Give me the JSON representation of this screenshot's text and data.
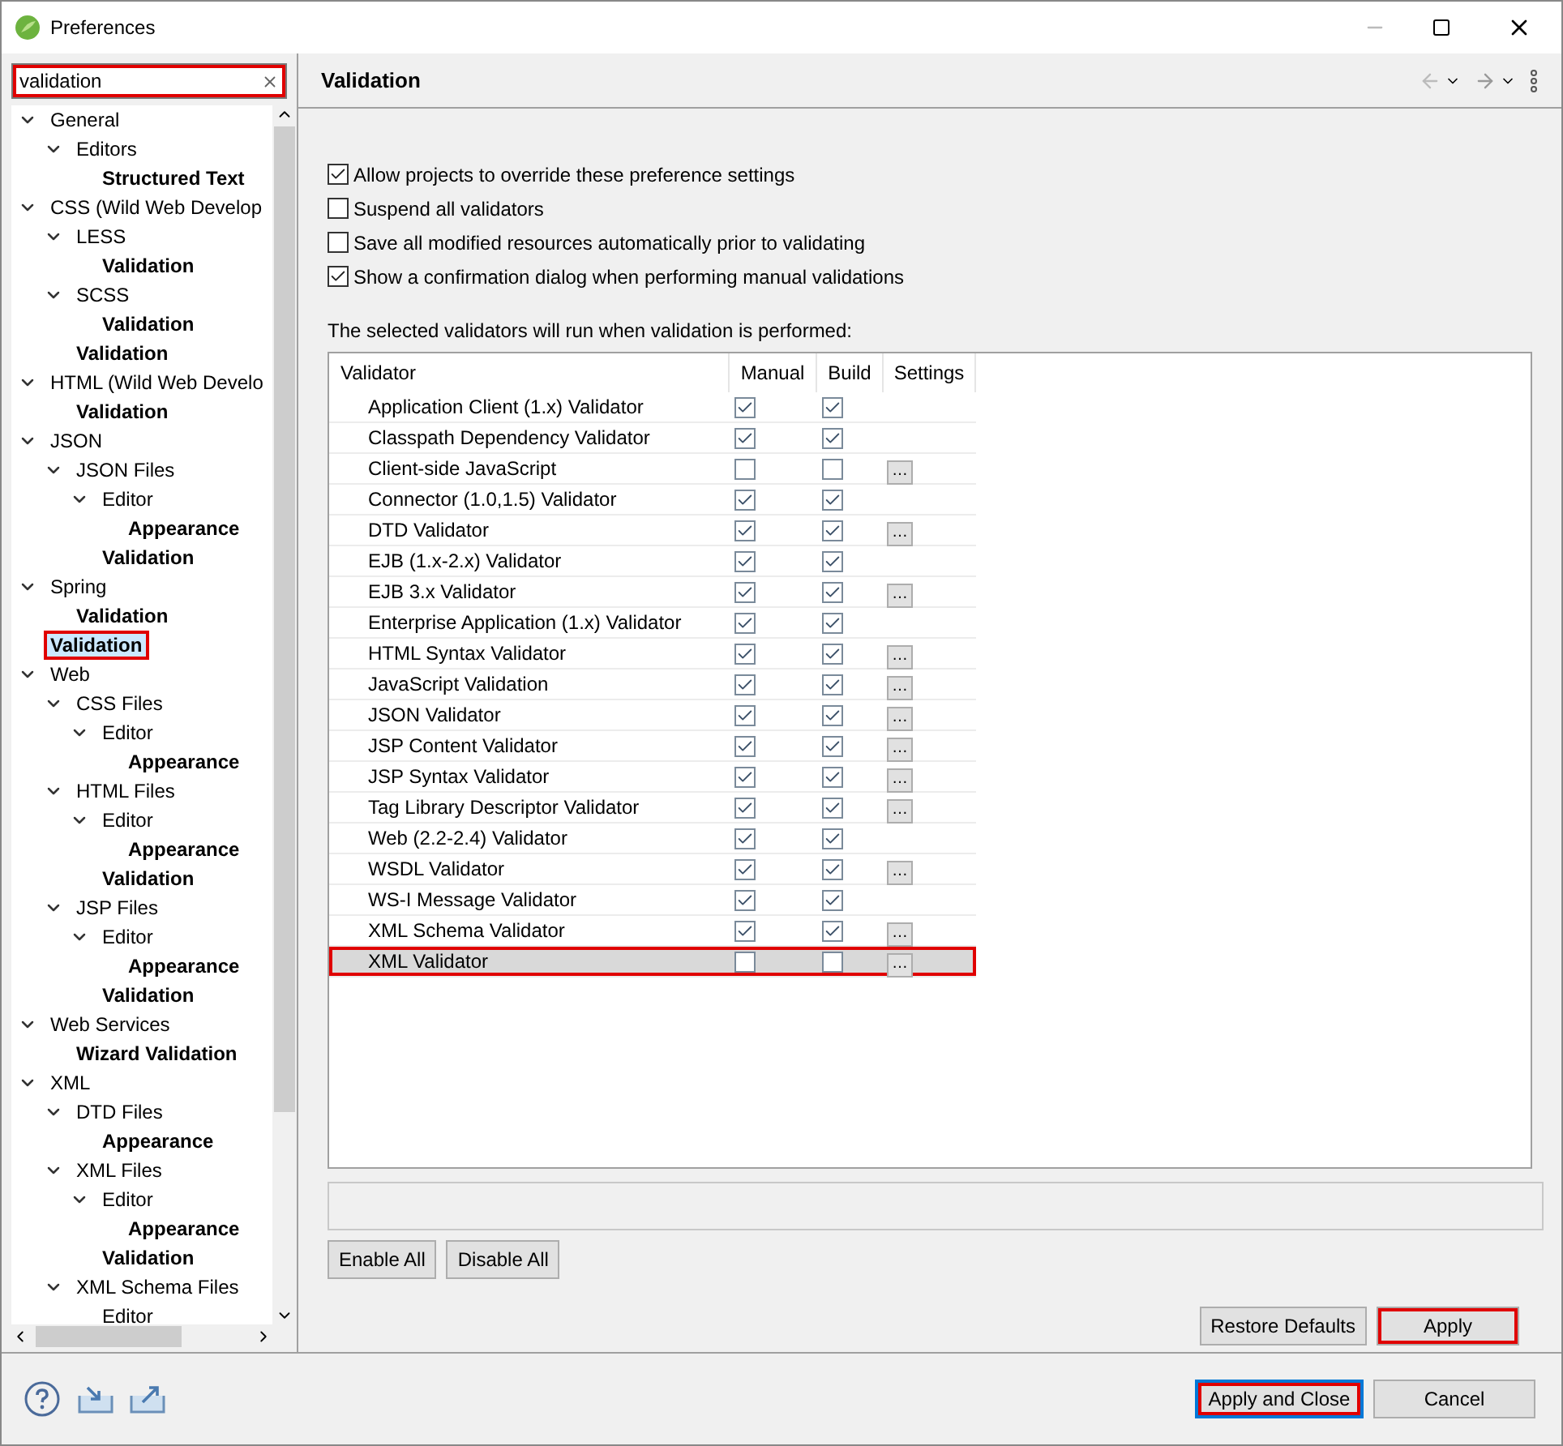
{
  "window": {
    "title": "Preferences"
  },
  "search": {
    "value": "validation",
    "annotated": true
  },
  "tree": [
    {
      "label": "General",
      "match": false,
      "selected": false,
      "children": [
        {
          "label": "Editors",
          "match": false,
          "selected": false,
          "children": [
            {
              "label": "Structured Text",
              "match": true,
              "selected": false
            }
          ]
        }
      ]
    },
    {
      "label": "CSS (Wild Web Develop",
      "match": false,
      "selected": false,
      "children": [
        {
          "label": "LESS",
          "match": false,
          "selected": false,
          "children": [
            {
              "label": "Validation",
              "match": true,
              "selected": false
            }
          ]
        },
        {
          "label": "SCSS",
          "match": false,
          "selected": false,
          "children": [
            {
              "label": "Validation",
              "match": true,
              "selected": false
            }
          ]
        },
        {
          "label": "Validation",
          "match": true,
          "selected": false
        }
      ]
    },
    {
      "label": "HTML (Wild Web Develo",
      "match": false,
      "selected": false,
      "children": [
        {
          "label": "Validation",
          "match": true,
          "selected": false
        }
      ]
    },
    {
      "label": "JSON",
      "match": false,
      "selected": false,
      "children": [
        {
          "label": "JSON Files",
          "match": false,
          "selected": false,
          "children": [
            {
              "label": "Editor",
              "match": false,
              "selected": false,
              "children": [
                {
                  "label": "Appearance",
                  "match": true,
                  "selected": false
                }
              ]
            },
            {
              "label": "Validation",
              "match": true,
              "selected": false
            }
          ]
        }
      ]
    },
    {
      "label": "Spring",
      "match": false,
      "selected": false,
      "children": [
        {
          "label": "Validation",
          "match": true,
          "selected": false
        }
      ]
    },
    {
      "label": "Validation",
      "match": true,
      "selected": true,
      "annotated": true
    },
    {
      "label": "Web",
      "match": false,
      "selected": false,
      "children": [
        {
          "label": "CSS Files",
          "match": false,
          "selected": false,
          "children": [
            {
              "label": "Editor",
              "match": false,
              "selected": false,
              "children": [
                {
                  "label": "Appearance",
                  "match": true,
                  "selected": false
                }
              ]
            }
          ]
        },
        {
          "label": "HTML Files",
          "match": false,
          "selected": false,
          "children": [
            {
              "label": "Editor",
              "match": false,
              "selected": false,
              "children": [
                {
                  "label": "Appearance",
                  "match": true,
                  "selected": false
                }
              ]
            },
            {
              "label": "Validation",
              "match": true,
              "selected": false
            }
          ]
        },
        {
          "label": "JSP Files",
          "match": false,
          "selected": false,
          "children": [
            {
              "label": "Editor",
              "match": false,
              "selected": false,
              "children": [
                {
                  "label": "Appearance",
                  "match": true,
                  "selected": false
                }
              ]
            },
            {
              "label": "Validation",
              "match": true,
              "selected": false
            }
          ]
        }
      ]
    },
    {
      "label": "Web Services",
      "match": false,
      "selected": false,
      "children": [
        {
          "label": "Wizard Validation",
          "match": true,
          "selected": false
        }
      ]
    },
    {
      "label": "XML",
      "match": false,
      "selected": false,
      "children": [
        {
          "label": "DTD Files",
          "match": false,
          "selected": false,
          "children": [
            {
              "label": "Appearance",
              "match": true,
              "selected": false
            }
          ]
        },
        {
          "label": "XML Files",
          "match": false,
          "selected": false,
          "children": [
            {
              "label": "Editor",
              "match": false,
              "selected": false,
              "children": [
                {
                  "label": "Appearance",
                  "match": true,
                  "selected": false
                }
              ]
            },
            {
              "label": "Validation",
              "match": true,
              "selected": false
            }
          ]
        },
        {
          "label": "XML Schema Files",
          "match": false,
          "selected": false,
          "children": [
            {
              "label": "Editor",
              "match": false,
              "selected": false
            }
          ]
        }
      ]
    }
  ],
  "page": {
    "title": "Validation",
    "options": [
      {
        "label": "Allow projects to override these preference settings",
        "checked": true
      },
      {
        "label": "Suspend all validators",
        "checked": false
      },
      {
        "label": "Save all modified resources automatically prior to validating",
        "checked": false
      },
      {
        "label": "Show a confirmation dialog when performing manual validations",
        "checked": true
      }
    ],
    "table_caption": "The selected validators will run when validation is performed:",
    "columns": [
      "Validator",
      "Manual",
      "Build",
      "Settings"
    ],
    "rows": [
      {
        "name": "Application Client (1.x) Validator",
        "manual": true,
        "build": true,
        "settings": null,
        "selected": false
      },
      {
        "name": "Classpath Dependency Validator",
        "manual": true,
        "build": true,
        "settings": null,
        "selected": false
      },
      {
        "name": "Client-side JavaScript",
        "manual": false,
        "build": false,
        "settings": "…",
        "selected": false
      },
      {
        "name": "Connector (1.0,1.5) Validator",
        "manual": true,
        "build": true,
        "settings": null,
        "selected": false
      },
      {
        "name": "DTD Validator",
        "manual": true,
        "build": true,
        "settings": "…",
        "selected": false
      },
      {
        "name": "EJB (1.x-2.x) Validator",
        "manual": true,
        "build": true,
        "settings": null,
        "selected": false
      },
      {
        "name": "EJB 3.x Validator",
        "manual": true,
        "build": true,
        "settings": "…",
        "selected": false
      },
      {
        "name": "Enterprise Application (1.x) Validator",
        "manual": true,
        "build": true,
        "settings": null,
        "selected": false
      },
      {
        "name": "HTML Syntax Validator",
        "manual": true,
        "build": true,
        "settings": "…",
        "selected": false
      },
      {
        "name": "JavaScript Validation",
        "manual": true,
        "build": true,
        "settings": "…",
        "selected": false
      },
      {
        "name": "JSON Validator",
        "manual": true,
        "build": true,
        "settings": "…",
        "selected": false
      },
      {
        "name": "JSP Content Validator",
        "manual": true,
        "build": true,
        "settings": "…",
        "selected": false
      },
      {
        "name": "JSP Syntax Validator",
        "manual": true,
        "build": true,
        "settings": "…",
        "selected": false
      },
      {
        "name": "Tag Library Descriptor Validator",
        "manual": true,
        "build": true,
        "settings": "…",
        "selected": false
      },
      {
        "name": "Web (2.2-2.4) Validator",
        "manual": true,
        "build": true,
        "settings": null,
        "selected": false
      },
      {
        "name": "WSDL Validator",
        "manual": true,
        "build": true,
        "settings": "…",
        "selected": false
      },
      {
        "name": "WS-I Message Validator",
        "manual": true,
        "build": true,
        "settings": null,
        "selected": false
      },
      {
        "name": "XML Schema Validator",
        "manual": true,
        "build": true,
        "settings": "…",
        "selected": false
      },
      {
        "name": "XML Validator",
        "manual": false,
        "build": false,
        "settings": "…",
        "selected": true,
        "annotated": true
      }
    ],
    "table_buttons": [
      "Enable All",
      "Disable All"
    ],
    "restore_defaults": {
      "label": "Restore Defaults"
    },
    "apply": {
      "label": "Apply",
      "annotated": true
    }
  },
  "footer": {
    "apply_and_close": {
      "label": "Apply and Close",
      "annotated": true
    },
    "cancel": {
      "label": "Cancel"
    }
  }
}
